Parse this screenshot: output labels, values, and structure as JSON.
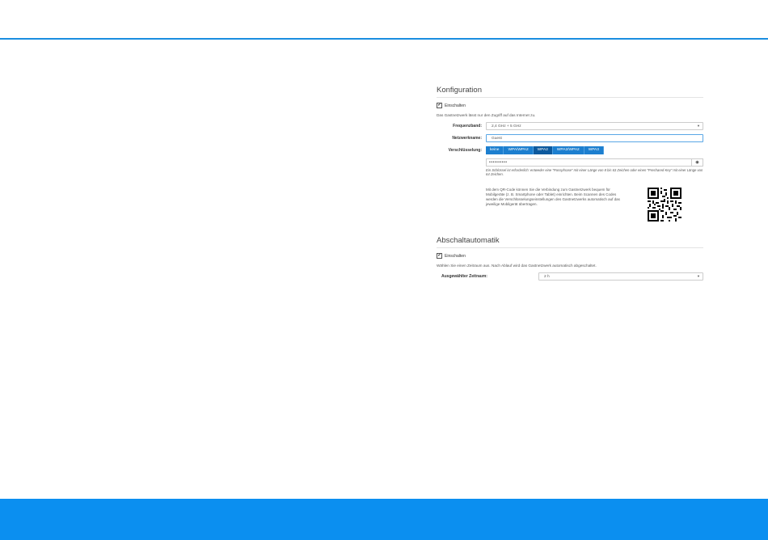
{
  "colors": {
    "accent": "#1a8ee0",
    "footer": "#0b8ff0",
    "button_active": "#0d5a9e",
    "button": "#1d7fcf"
  },
  "konfiguration": {
    "title": "Konfiguration",
    "enable_label": "Einschalten",
    "enabled": true,
    "info": "Das Gastnetzwerk lässt nur den Zugriff auf das Internet zu.",
    "frequency_label": "Frequenzband:",
    "frequency_value": "2,4 GHz + 5 GHz",
    "network_label": "Netzwerkname:",
    "network_value": "Guest",
    "encryption_label": "Verschlüsselung:",
    "encryption_options": [
      "keine",
      "WPA/WPA2",
      "WPA2",
      "WPA2/WPA2",
      "WPA3"
    ],
    "encryption_selected": "WPA2",
    "password_mask": "••••••••••",
    "eye_icon": "◉",
    "hint": "Ein Schlüssel ist erforderlich: entweder eine \"Passphrase\" mit einer Länge von 8 bis 63 Zeichen oder einen \"Preshared-Key\" mit einer Länge von 64 Zeichen.",
    "qr_text": "Mit dem QR-Code können Sie die Verbindung zum Gastnetzwerk bequem für Mobilgeräte (z. B. Smartphone oder Tablet) einrichten. Beim Scannen des Codes werden die Verschlüsselungseinstellungen des Gastnetzwerks automatisch auf das jeweilige Mobilgerät übertragen."
  },
  "abschaltautomatik": {
    "title": "Abschaltautomatik",
    "enable_label": "Einschalten",
    "enabled": true,
    "info": "Wählen Sie einen Zeitraum aus. Nach Ablauf wird das Gastnetzwerk automatisch abgeschaltet.",
    "period_label": "Ausgewählter Zeitraum:",
    "period_value": "2 h"
  }
}
